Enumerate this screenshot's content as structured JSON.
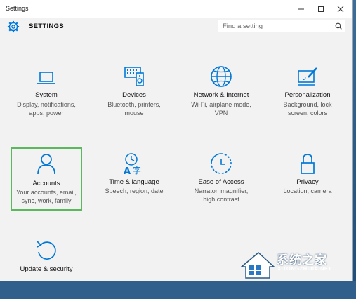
{
  "window": {
    "title": "Settings"
  },
  "header": {
    "title": "SETTINGS",
    "search_placeholder": "Find a setting"
  },
  "tiles": [
    {
      "name": "System",
      "desc1": "Display, notifications,",
      "desc2": "apps, power",
      "desc3": ""
    },
    {
      "name": "Devices",
      "desc1": "Bluetooth, printers,",
      "desc2": "mouse",
      "desc3": ""
    },
    {
      "name": "Network & Internet",
      "desc1": "Wi-Fi, airplane mode,",
      "desc2": "VPN",
      "desc3": ""
    },
    {
      "name": "Personalization",
      "desc1": "Background, lock",
      "desc2": "screen, colors",
      "desc3": ""
    },
    {
      "name": "Accounts",
      "desc1": "Your accounts, email,",
      "desc2": "sync, work, family",
      "desc3": ""
    },
    {
      "name": "Time & language",
      "desc1": "Speech, region, date",
      "desc2": "",
      "desc3": ""
    },
    {
      "name": "Ease of Access",
      "desc1": "Narrator, magnifier,",
      "desc2": "high contrast",
      "desc3": ""
    },
    {
      "name": "Privacy",
      "desc1": "Location, camera",
      "desc2": "",
      "desc3": ""
    },
    {
      "name": "Update & security",
      "desc1": "",
      "desc2": "",
      "desc3": ""
    }
  ],
  "watermark": {
    "line1": "系统之家",
    "line2": "XITONGZHIJIA.NET"
  },
  "colors": {
    "accent": "#0078d7",
    "selected_border": "#5cb85c"
  }
}
